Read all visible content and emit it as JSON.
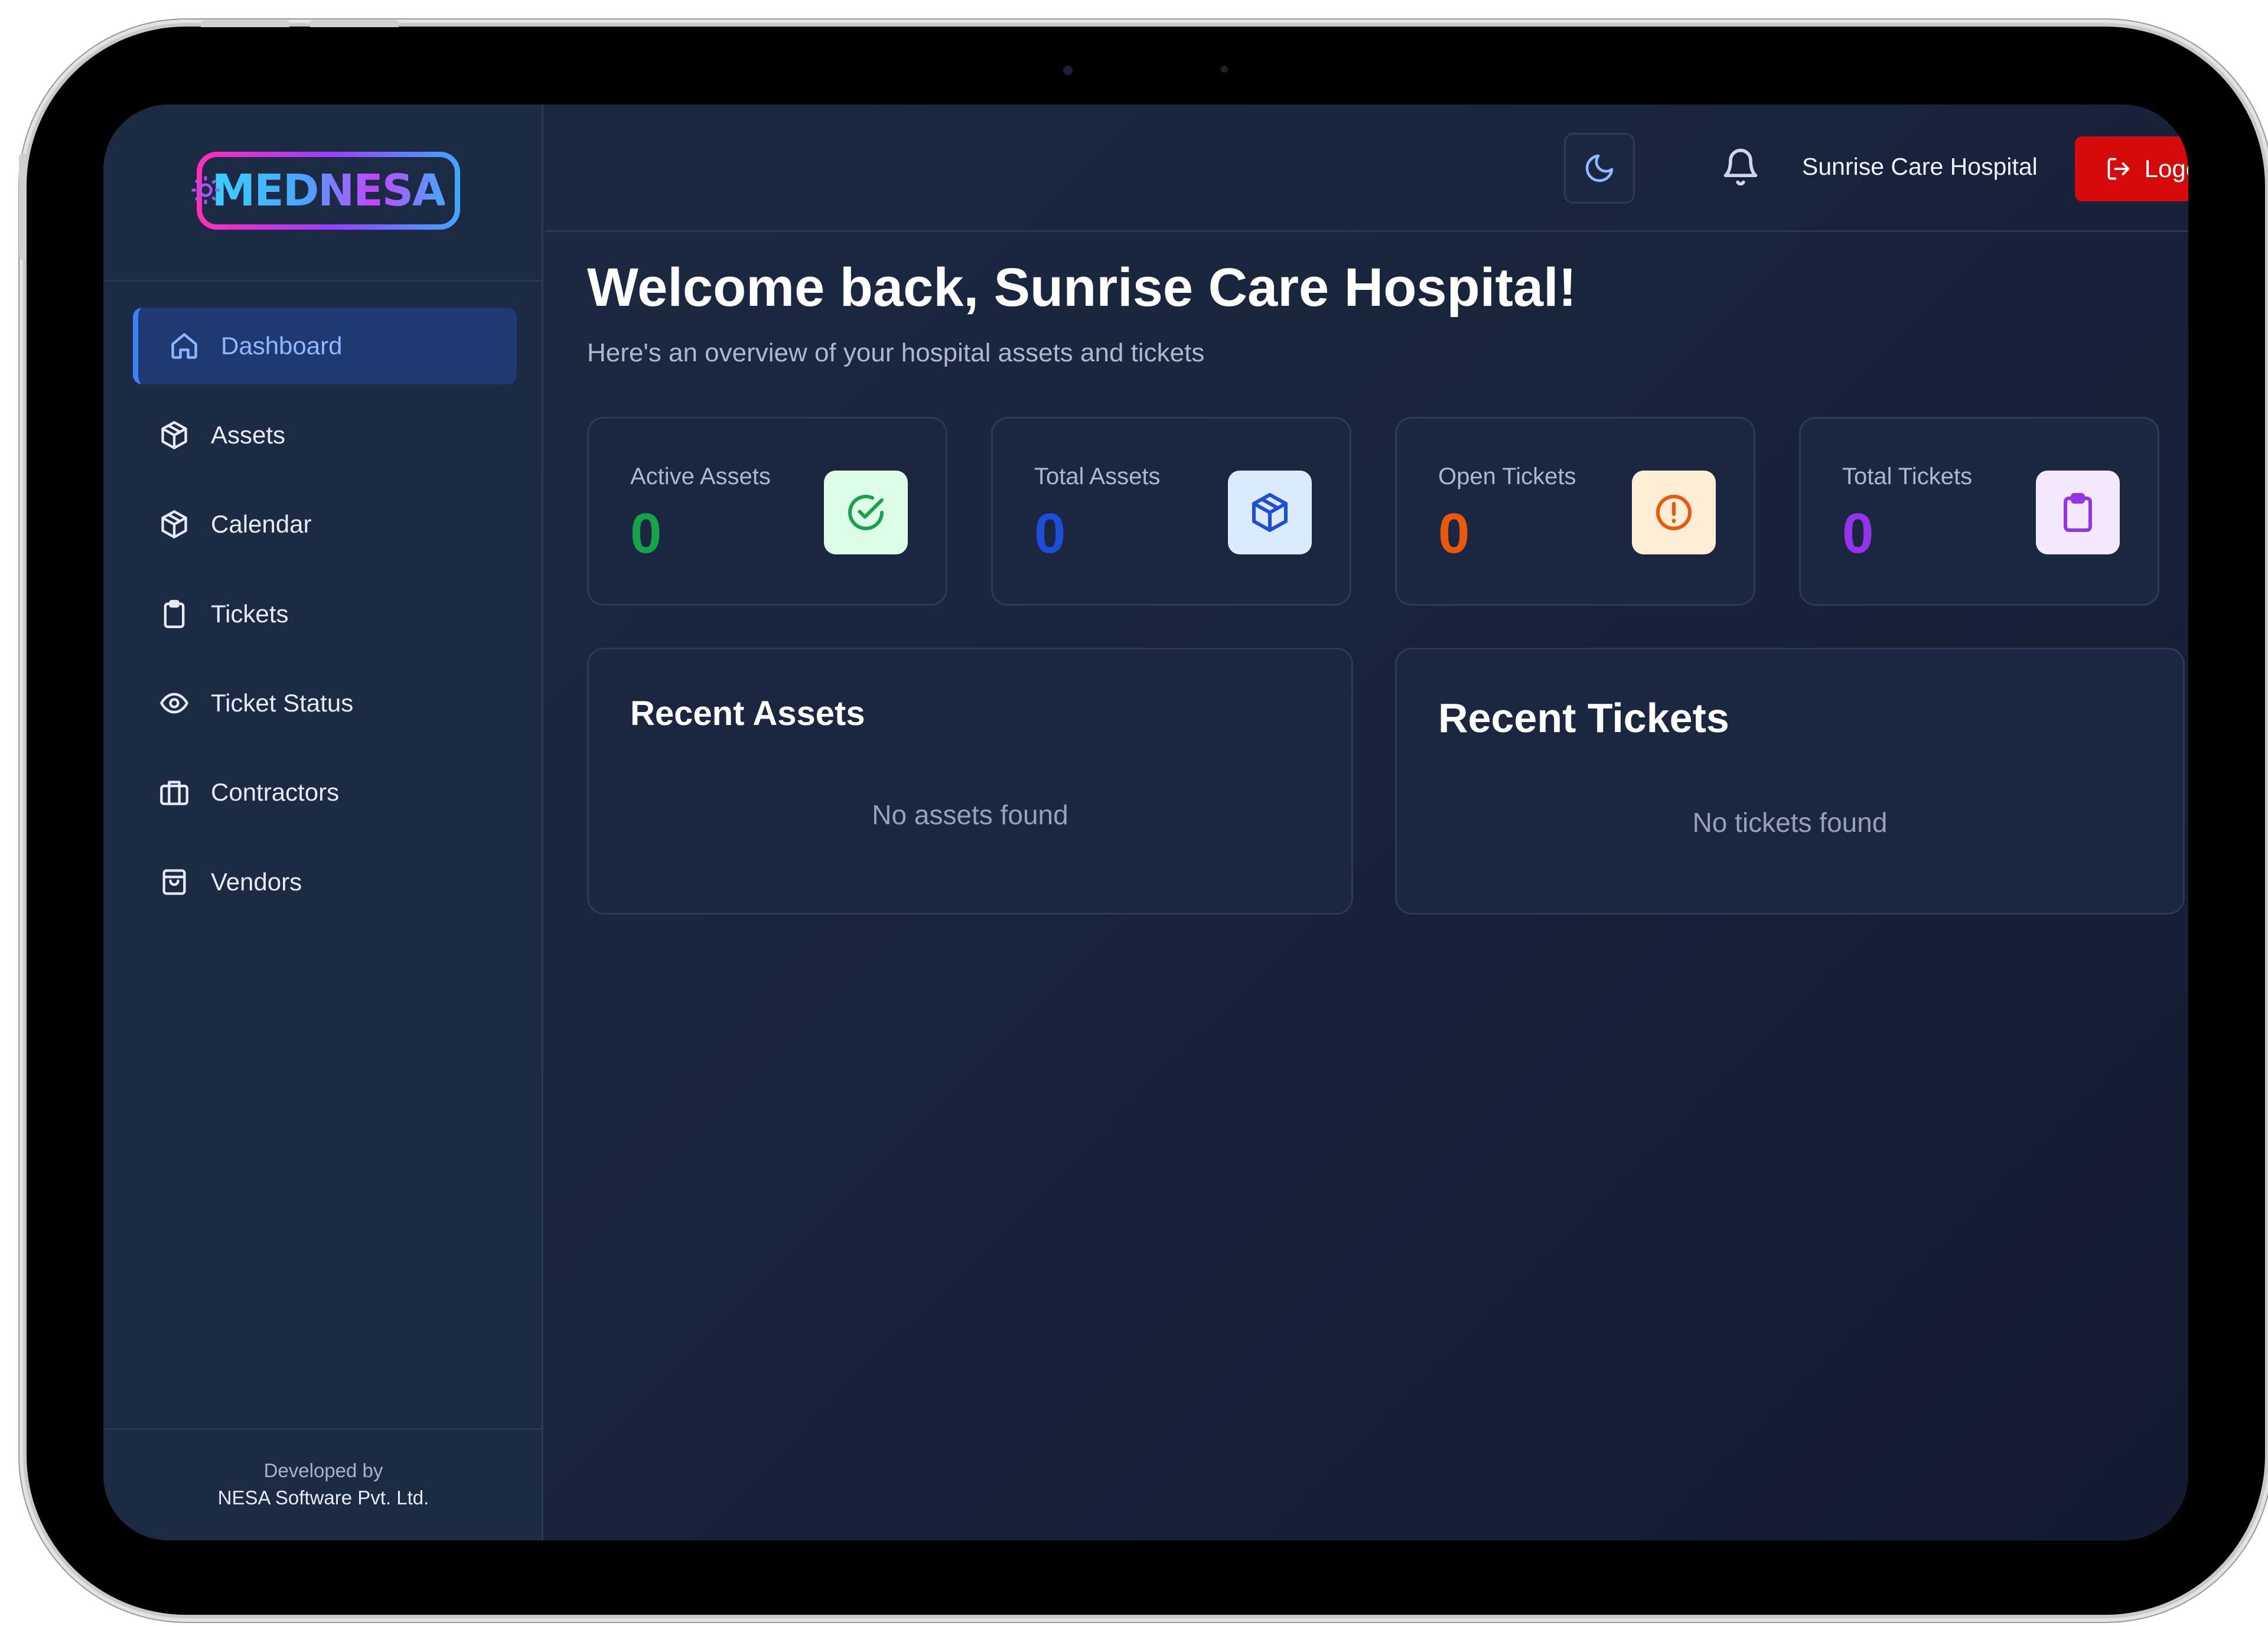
{
  "app": {
    "logo_text": "MEDNESA",
    "logo_icon": "gear-caduceus-icon"
  },
  "sidebar": {
    "items": [
      {
        "label": "Dashboard",
        "icon": "home-icon",
        "active": true
      },
      {
        "label": "Assets",
        "icon": "cube-icon",
        "active": false
      },
      {
        "label": "Calendar",
        "icon": "cube-icon",
        "active": false
      },
      {
        "label": "Tickets",
        "icon": "clipboard-icon",
        "active": false
      },
      {
        "label": "Ticket Status",
        "icon": "eye-icon",
        "active": false
      },
      {
        "label": "Contractors",
        "icon": "briefcase-icon",
        "active": false
      },
      {
        "label": "Vendors",
        "icon": "shopping-bag-icon",
        "active": false
      }
    ],
    "footer": {
      "developed_by": "Developed by",
      "company": "NESA Software Pvt. Ltd."
    }
  },
  "header": {
    "theme_icon": "moon-icon",
    "notification_icon": "bell-icon",
    "user_name": "Sunrise Care Hospital",
    "logout_label": "Logout",
    "logout_icon": "logout-icon"
  },
  "main": {
    "welcome": "Welcome back, Sunrise Care Hospital!",
    "subtitle": "Here's an overview of your hospital assets and tickets",
    "stats": [
      {
        "label": "Active Assets",
        "value": "0",
        "color": "#16a34a",
        "icon": "check-circle-icon",
        "icon_bg": "#dcfce7"
      },
      {
        "label": "Total Assets",
        "value": "0",
        "color": "#1d4ed8",
        "icon": "cube-icon",
        "icon_bg": "#dbeafe"
      },
      {
        "label": "Open Tickets",
        "value": "0",
        "color": "#ea580c",
        "icon": "alert-circle-icon",
        "icon_bg": "#ffedd5"
      },
      {
        "label": "Total Tickets",
        "value": "0",
        "color": "#9333ea",
        "icon": "clipboard-icon",
        "icon_bg": "#f3e8ff"
      }
    ],
    "recent_assets": {
      "title": "Recent Assets",
      "empty": "No assets found"
    },
    "recent_tickets": {
      "title": "Recent Tickets",
      "empty": "No tickets found"
    }
  },
  "colors": {
    "accent": "#3b82f6",
    "danger": "#d60a0a",
    "surface": "#1b2740",
    "sidebar": "#1d2a44"
  }
}
